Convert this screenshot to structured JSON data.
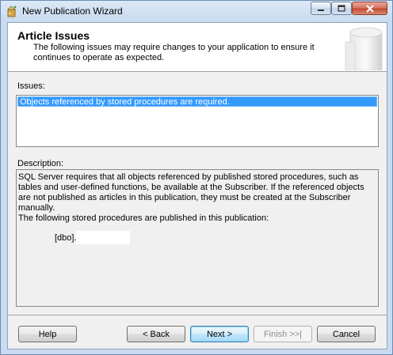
{
  "window": {
    "title": "New Publication Wizard"
  },
  "header": {
    "title": "Article Issues",
    "subtitle": "The following issues may require changes to your application to ensure it continues to operate as expected."
  },
  "issues": {
    "label": "Issues:",
    "items": [
      {
        "text": "Objects referenced by stored procedures are required.",
        "selected": true
      }
    ]
  },
  "description": {
    "label": "Description:",
    "paragraph1": "SQL Server requires that all objects referenced by published stored procedures, such as tables and user-defined functions, be available at the Subscriber. If the referenced objects are not published as articles in this publication, they must be created at the Subscriber manually.",
    "paragraph2": "The following stored procedures are published in this publication:",
    "procedure_prefix": "[dbo]."
  },
  "buttons": {
    "help": "Help",
    "back": "< Back",
    "next": "Next >",
    "finish": "Finish >>|",
    "cancel": "Cancel"
  },
  "colors": {
    "selection": "#3399ff",
    "title_bar": "#cfe0f3",
    "close_button": "#c3462f"
  }
}
